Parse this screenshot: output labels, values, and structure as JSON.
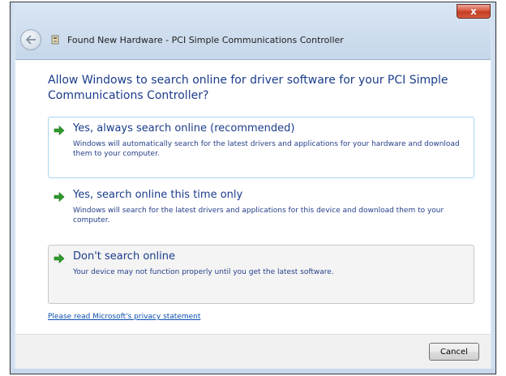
{
  "window": {
    "title": "Found New Hardware - PCI Simple Communications Controller",
    "close_label": "x"
  },
  "dialog": {
    "question": "Allow Windows to search online for driver software for your PCI Simple Communications Controller?",
    "options": [
      {
        "title": "Yes, always search online (recommended)",
        "description": "Windows will automatically search for the latest drivers and applications for your hardware and download them to your computer."
      },
      {
        "title": "Yes, search online this time only",
        "description": "Windows will search for the latest drivers and applications for this device and download them to your computer."
      },
      {
        "title": "Don't search online",
        "description": "Your device may not function properly until you get the latest software."
      }
    ],
    "privacy_link": "Please read Microsoft's privacy statement",
    "cancel_label": "Cancel"
  },
  "colors": {
    "heading": "#1a3c8b",
    "arrow": "#2e9a2a",
    "link": "#0b4fb0",
    "close_button": "#c23d22"
  },
  "icons": {
    "back": "back-arrow-icon",
    "device": "hardware-device-icon",
    "option_arrow": "green-arrow-icon"
  }
}
